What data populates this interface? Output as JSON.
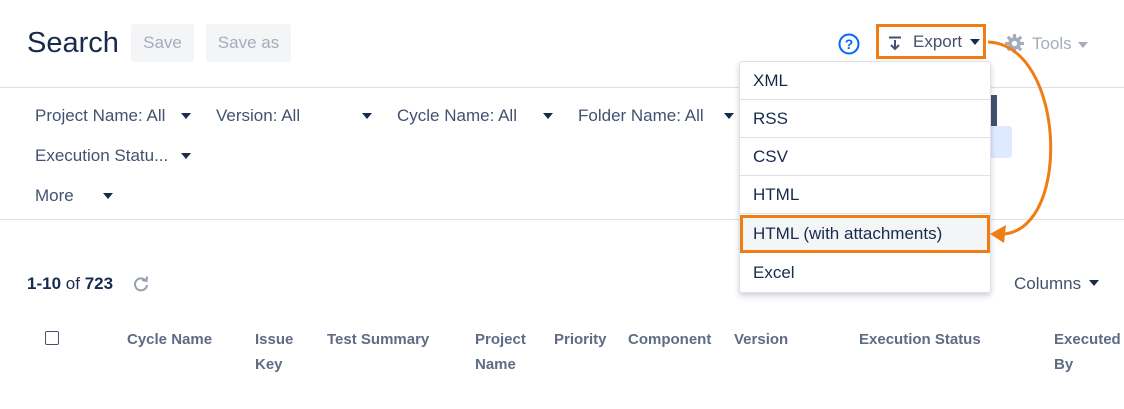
{
  "header": {
    "title": "Search",
    "save_label": "Save",
    "save_as_label": "Save as",
    "help_icon": "question-circle-icon",
    "export_label": "Export",
    "tools_label": "Tools"
  },
  "filters": [
    {
      "label": "Project Name: All"
    },
    {
      "label": "Version: All"
    },
    {
      "label": "Cycle Name: All"
    },
    {
      "label": "Folder Name: All"
    },
    {
      "label": "Execution Statu..."
    },
    {
      "label": "More"
    }
  ],
  "results": {
    "range": "1-10",
    "of_label": "of",
    "total": "723",
    "columns_label": "Columns"
  },
  "table": {
    "headers": [
      "Cycle Name",
      "Issue Key",
      "Test Summary",
      "Project Name",
      "Priority",
      "Component",
      "Version",
      "Execution Status",
      "Executed By"
    ]
  },
  "export_menu": {
    "items": [
      "XML",
      "RSS",
      "CSV",
      "HTML",
      "HTML (with attachments)",
      "Excel"
    ],
    "highlighted": "HTML (with attachments)"
  },
  "colors": {
    "annotation": "#f07d14",
    "help": "#0065ff",
    "text": "#172b4d"
  }
}
